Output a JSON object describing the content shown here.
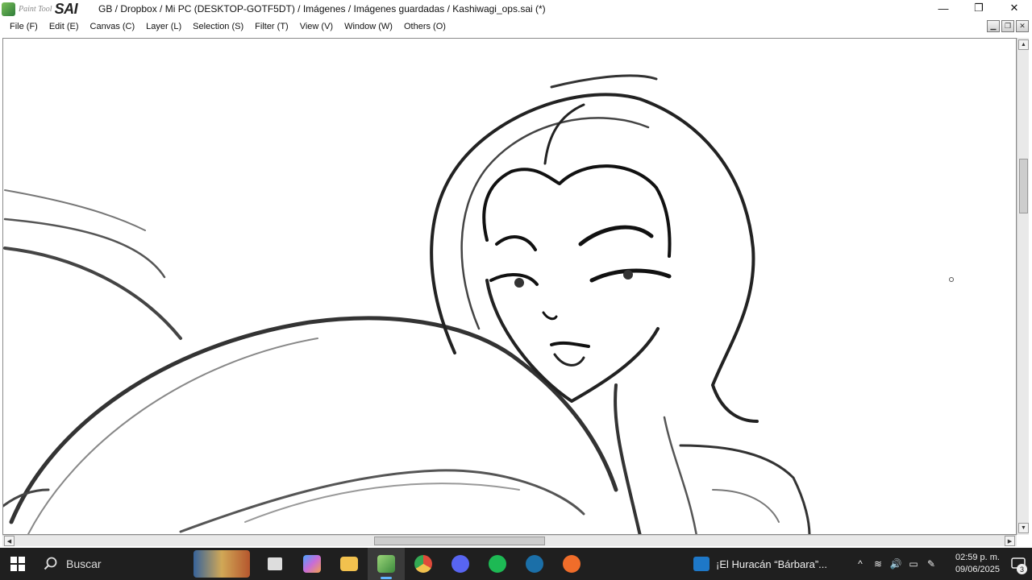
{
  "window": {
    "logo_text_small": "Paint Tool",
    "logo_text_big": "SAI",
    "title": "GB / Dropbox / Mi PC (DESKTOP-GOTF5DT) / Imágenes / Imágenes guardadas / Kashiwagi_ops.sai (*)",
    "controls": {
      "minimize": "—",
      "restore": "❐",
      "close": "✕"
    }
  },
  "menu": {
    "items": [
      "File (F)",
      "Edit (E)",
      "Canvas (C)",
      "Layer (L)",
      "Selection (S)",
      "Filter (T)",
      "View (V)",
      "Window (W)",
      "Others (O)"
    ]
  },
  "mdi_controls": {
    "minimize": "▁",
    "restore": "❐",
    "close": "✕"
  },
  "canvas": {
    "document": "Kashiwagi_ops.sai",
    "content": "sketch-drawing"
  },
  "scrollbars": {
    "up_arrow": "▲",
    "down_arrow": "▼",
    "left_arrow": "◀",
    "right_arrow": "▶"
  },
  "taskbar": {
    "search_placeholder": "Buscar",
    "apps": [
      {
        "icon": "task-view-icon",
        "color": "#dddddd"
      },
      {
        "icon": "copilot-icon",
        "color": "#c86cd8"
      },
      {
        "icon": "file-explorer-icon",
        "color": "#f2c14e"
      },
      {
        "icon": "painttool-sai-icon",
        "color": "#5aa04a",
        "active": true
      },
      {
        "icon": "chrome-icon",
        "color": "#e04a3a"
      },
      {
        "icon": "discord-icon",
        "color": "#5865f2"
      },
      {
        "icon": "spotify-icon",
        "color": "#1db954"
      },
      {
        "icon": "steam-icon",
        "color": "#1b6fa8"
      },
      {
        "icon": "origin-icon",
        "color": "#f06d2a"
      }
    ],
    "media_title": "¡El Huracán “Bárbara”...",
    "tray": {
      "chevron": "^",
      "network": "≋",
      "volume": "🔊",
      "battery": "▭",
      "pen": "✎"
    },
    "time": "02:59 p. m.",
    "date": "09/06/2025",
    "notifications": "3"
  }
}
